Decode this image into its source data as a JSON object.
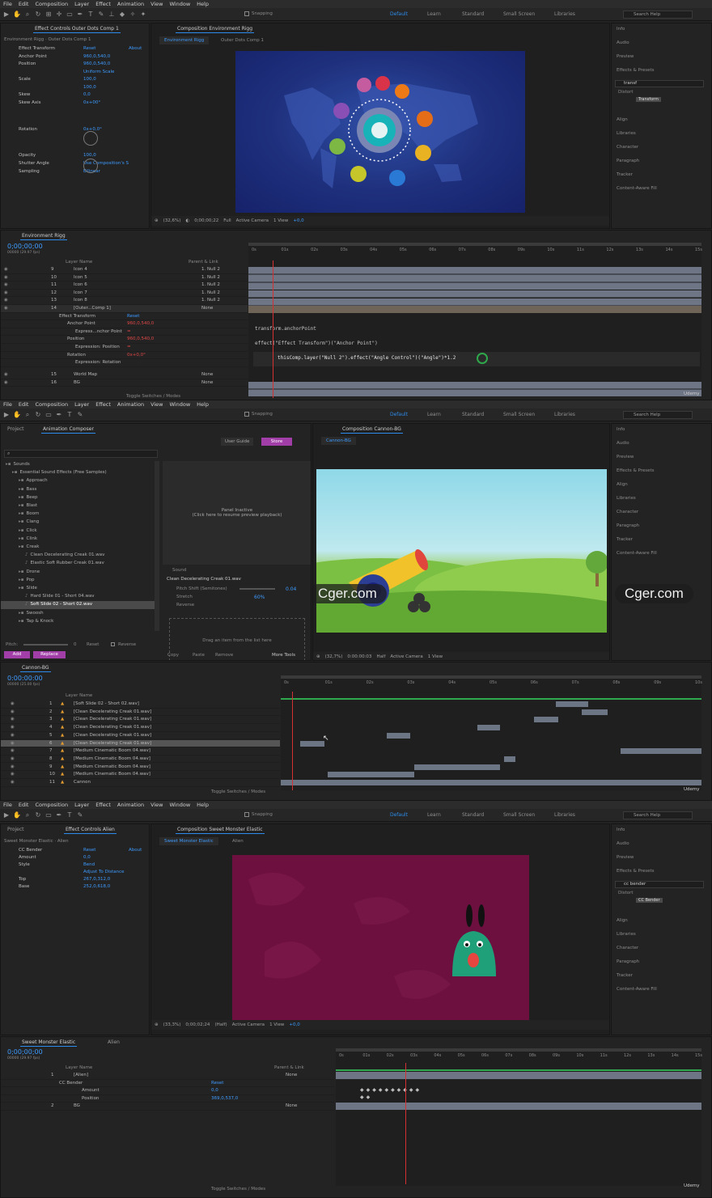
{
  "menu": [
    "File",
    "Edit",
    "Composition",
    "Layer",
    "Effect",
    "Animation",
    "View",
    "Window",
    "Help"
  ],
  "workspaces": [
    "Default",
    "Learn",
    "Standard",
    "Small Screen",
    "Libraries"
  ],
  "search_help": "Search Help",
  "snapping": "Snapping",
  "right_panels1": [
    "Info",
    "Audio",
    "Preview",
    "Effects & Presets"
  ],
  "right_panels_tail": [
    "Align",
    "Libraries",
    "Character",
    "Paragraph",
    "Tracker",
    "Content-Aware Fill"
  ],
  "s1": {
    "ec_tab": "Effect Controls Outer Dots Comp 1",
    "ec_sub": "Environment Rigg · Outer Dots Comp 1",
    "ec_rows": [
      {
        "label": "Effect Transform",
        "val": "Reset",
        "val2": "About"
      },
      {
        "label": "Anchor Point",
        "val": "960,0,540,0"
      },
      {
        "label": "Position",
        "val": "960,0,540,0"
      },
      {
        "label": "",
        "val": "Uniform Scale"
      },
      {
        "label": "Scale",
        "val": "100,0"
      },
      {
        "label": "",
        "val": "100,0"
      },
      {
        "label": "Skew",
        "val": "0,0"
      },
      {
        "label": "Skew Axis",
        "val": "0x+00°"
      },
      {
        "label": "Rotation",
        "val": "0x+0,0°"
      },
      {
        "label": "Opacity",
        "val": "100,0"
      },
      {
        "label": "Shutter Angle",
        "val": "Use Composition's S"
      },
      {
        "label": "Sampling",
        "val": "Bilinear"
      }
    ],
    "comp_tab": "Composition Environment Rigg",
    "comp_sub_tabs": [
      "Environment Rigg",
      "Outer Dots Comp 1"
    ],
    "viewer_bar": [
      "(32,6%)",
      "0;00;00;22",
      "Full",
      "Active Camera",
      "1 View",
      "+0,0"
    ],
    "effects_search": "transf",
    "effects_cat": "Distort",
    "effects_item": "Transform",
    "tl_tab": "Environment Rigg",
    "timecode": "0;00;00;00",
    "fps": "00000 (29.97 fps)",
    "col_layer": "Layer Name",
    "col_parent": "Parent & Link",
    "layers": [
      {
        "num": "9",
        "name": "Icon 4",
        "parent": "1. Null 2"
      },
      {
        "num": "10",
        "name": "Icon 5",
        "parent": "1. Null 2"
      },
      {
        "num": "11",
        "name": "Icon 6",
        "parent": "1. Null 2"
      },
      {
        "num": "12",
        "name": "Icon 7",
        "parent": "1. Null 2"
      },
      {
        "num": "13",
        "name": "Icon  8",
        "parent": "1. Null 2"
      },
      {
        "num": "14",
        "name": "[Outer...Comp 1]",
        "parent": "None"
      }
    ],
    "props": [
      {
        "label": "Effect Transform",
        "val": "Reset"
      },
      {
        "label": "Anchor Point",
        "val": "960,0,540,0"
      },
      {
        "label": "Express...nchor Point",
        "val": "="
      },
      {
        "label": "Position",
        "val": "960,0,540,0"
      },
      {
        "label": "Expression: Position",
        "val": "="
      },
      {
        "label": "Rotation",
        "val": "0x+0,0°"
      },
      {
        "label": "Expression: Rotation",
        "val": ""
      }
    ],
    "layers_bottom": [
      {
        "num": "15",
        "name": "World Map",
        "parent": "None"
      },
      {
        "num": "16",
        "name": "BG",
        "parent": "None"
      }
    ],
    "ruler": [
      "0s",
      "01s",
      "02s",
      "03s",
      "04s",
      "05s",
      "06s",
      "07s",
      "08s",
      "09s",
      "10s",
      "11s",
      "12s",
      "13s",
      "14s",
      "15s"
    ],
    "code1": "transform.anchorPoint",
    "code2": "effect(\"Effect Transform\")(\"Anchor Point\")",
    "code3": "thisComp.layer(\"Null 2\").effect(\"Angle Control\")(\"Angle\")*1.2",
    "toggle": "Toggle Switches / Modes",
    "udemy": "Udemy"
  },
  "s2": {
    "tabs": [
      "Project",
      "Animation Composer"
    ],
    "guide": "User Guide",
    "store": "Store",
    "tree": [
      {
        "t": "Sounds",
        "d": 0
      },
      {
        "t": "Essential Sound Effects (Free Samples)",
        "d": 1
      },
      {
        "t": "Approach",
        "d": 2
      },
      {
        "t": "Bass",
        "d": 2
      },
      {
        "t": "Beep",
        "d": 2
      },
      {
        "t": "Blast",
        "d": 2
      },
      {
        "t": "Boom",
        "d": 2
      },
      {
        "t": "Clang",
        "d": 2
      },
      {
        "t": "Click",
        "d": 2
      },
      {
        "t": "Clink",
        "d": 2
      },
      {
        "t": "Creak",
        "d": 2
      },
      {
        "t": "Clean Decelerating Creak 01.wav",
        "d": 3
      },
      {
        "t": "Elastic Soft Rubber Creak 01.wav",
        "d": 3
      },
      {
        "t": "Drone",
        "d": 2
      },
      {
        "t": "Pop",
        "d": 2
      },
      {
        "t": "Slide",
        "d": 2
      },
      {
        "t": "Hard Slide 01 - Short 04.wav",
        "d": 3
      },
      {
        "t": "Soft Slide 02 - Short 02.wav",
        "d": 3
      },
      {
        "t": "Swoosh",
        "d": 2
      },
      {
        "t": "Tap & Knock",
        "d": 2
      }
    ],
    "inactive1": "Panel Inactive",
    "inactive2": "(Click here to resume preview playback)",
    "sound_hdr": "Sound",
    "sound_name": "Clean Decelerating Creak 01.wav",
    "pitch_label": "Pitch Shift (Semitones)",
    "pitch_val": "0.04",
    "stretch_label": "Stretch",
    "stretch_val": "60%",
    "reverse_label": "Reverse",
    "drag_text": "Drag an item from the list here",
    "pitch": "Pitch:",
    "pitch_zero": "0",
    "reset": "Reset",
    "reverse": "Reverse",
    "add": "Add",
    "replace": "Replace",
    "copy": "Copy",
    "paste": "Paste",
    "remove": "Remove",
    "more": "More Tools",
    "comp_tab": "Composition Cannon-BG",
    "comp_sub": "Cannon-BG",
    "viewer_bar": [
      "(32,7%)",
      "0:00:00:03",
      "Half",
      "Active Camera",
      "1 View"
    ],
    "tl_tab": "Cannon-BG",
    "timecode": "0:00:00:00",
    "fps": "00000 (25.00 fps)",
    "col_layer": "Layer Name",
    "layers": [
      {
        "num": "1",
        "name": "[Soft Slide 02 - Short 02.wav]"
      },
      {
        "num": "2",
        "name": "[Clean Decelerating Creak 01.wav]"
      },
      {
        "num": "3",
        "name": "[Clean Decelerating Creak 01.wav]"
      },
      {
        "num": "4",
        "name": "[Clean Decelerating Creak 01.wav]"
      },
      {
        "num": "5",
        "name": "[Clean Decelerating Creak 01.wav]"
      },
      {
        "num": "6",
        "name": "[Clean Decelerating Creak 01.wav]"
      },
      {
        "num": "7",
        "name": "[Medium Cinematic Boom 04.wav]"
      },
      {
        "num": "8",
        "name": "[Medium Cinematic Boom 04.wav]"
      },
      {
        "num": "9",
        "name": "[Medium Cinematic Boom 04.wav]"
      },
      {
        "num": "10",
        "name": "[Medium Cinematic Boom 04.wav]"
      },
      {
        "num": "11",
        "name": "Cannon"
      }
    ],
    "ruler": [
      "0s",
      "01s",
      "02s",
      "03s",
      "04s",
      "05s",
      "06s",
      "07s",
      "08s",
      "09s",
      "10s"
    ],
    "watermark": "Cger.com",
    "toggle": "Toggle Switches / Modes",
    "udemy": "Udemy"
  },
  "s3": {
    "tabs": [
      "Project",
      "Effect Controls Alien"
    ],
    "ec_sub": "Sweet Monster Elastic · Alien",
    "ec_rows": [
      {
        "label": "CC Bender",
        "val": "Reset",
        "val2": "About"
      },
      {
        "label": "Amount",
        "val": "0,0"
      },
      {
        "label": "Style",
        "val": "Bend"
      },
      {
        "label": "",
        "val": "Adjust To Distance"
      },
      {
        "label": "Top",
        "val": "267,0,312,0"
      },
      {
        "label": "Base",
        "val": "252,0,618,0"
      }
    ],
    "comp_tab": "Composition Sweet Monster Elastic",
    "comp_sub": [
      "Sweet Monster Elastic",
      "Alien"
    ],
    "viewer_bar": [
      "(33,3%)",
      "0;00;02;24",
      "(Half)",
      "Active Camera",
      "1 View",
      "+0,0"
    ],
    "effects_search": "cc bender",
    "effects_cat": "Distort",
    "effects_item": "CC Bender",
    "tl_tabs": [
      "Sweet Monster Elastic",
      "Alien"
    ],
    "timecode": "0;00;00;00",
    "fps": "00000 (29.97 fps)",
    "col_layer": "Layer Name",
    "col_parent": "Parent & Link",
    "rows": [
      {
        "num": "1",
        "name": "[Alien]",
        "parent": "None"
      },
      {
        "num": "",
        "name": "CC Bender",
        "parent": "Reset"
      },
      {
        "num": "",
        "name": "Amount",
        "parent": "0,0"
      },
      {
        "num": "",
        "name": "Position",
        "parent": "369,0,537,0"
      },
      {
        "num": "2",
        "name": "BG",
        "parent": "None"
      }
    ],
    "ruler": [
      "0s",
      "01s",
      "02s",
      "03s",
      "04s",
      "05s",
      "06s",
      "07s",
      "08s",
      "09s",
      "10s",
      "11s",
      "12s",
      "13s",
      "14s",
      "15s"
    ],
    "toggle": "Toggle Switches / Modes",
    "udemy": "Udemy"
  }
}
